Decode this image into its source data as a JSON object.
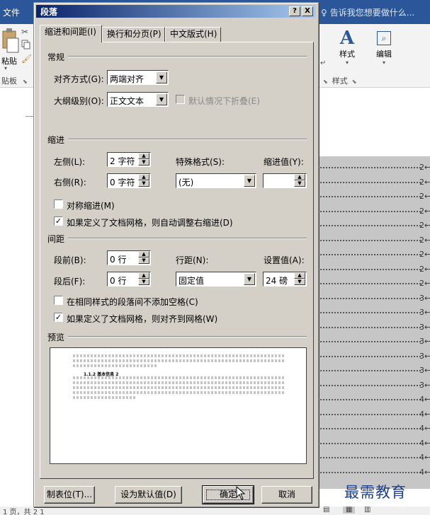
{
  "word": {
    "file_tab": "文件",
    "tell_me": "告诉我您想要做什么...",
    "paste_label": "粘贴",
    "clipboard_group": "贴板",
    "styles_label": "样式",
    "edit_label": "编辑",
    "styles_group": "样式",
    "line_marks": [
      "2←",
      "2←",
      "2←",
      "2←",
      "2←",
      "2←",
      "2←",
      "2←",
      "2←",
      "3←",
      "3←",
      "3←",
      "3←",
      "3←",
      "3←",
      "3←",
      "4←",
      "4←",
      "4←",
      "4←",
      "4←",
      "4←"
    ],
    "status_left": "1 页，共 2 1",
    "watermark": "最需教育"
  },
  "dialog": {
    "title": "段落",
    "help_btn": "?",
    "close_btn": "X",
    "tabs": [
      {
        "label": "缩进和间距(I)"
      },
      {
        "label": "换行和分页(P)"
      },
      {
        "label": "中文版式(H)"
      }
    ],
    "general": {
      "section": "常规",
      "alignment_label": "对齐方式(G):",
      "alignment_value": "两端对齐",
      "outline_label": "大纲级别(O):",
      "outline_value": "正文文本",
      "collapse_label": "默认情况下折叠(E)"
    },
    "indent": {
      "section": "缩进",
      "left_label": "左侧(L):",
      "left_value": "2 字符",
      "right_label": "右侧(R):",
      "right_value": "0 字符",
      "special_label": "特殊格式(S):",
      "special_value": "(无)",
      "by_label": "缩进值(Y):",
      "by_value": "",
      "mirror_label": "对称缩进(M)",
      "auto_adjust_label": "如果定义了文档网格，则自动调整右缩进(D)"
    },
    "spacing": {
      "section": "间距",
      "before_label": "段前(B):",
      "before_value": "0 行",
      "after_label": "段后(F):",
      "after_value": "0 行",
      "line_label": "行距(N):",
      "line_value": "固定值",
      "at_label": "设置值(A):",
      "at_value": "24 磅",
      "no_space_label": "在相同样式的段落间不添加空格(C)",
      "snap_grid_label": "如果定义了文档网格，则对齐到网格(W)"
    },
    "preview": {
      "section": "预览",
      "sample_heading": "1.1.2 基本信息 2"
    },
    "buttons": {
      "tabs": "制表位(T)...",
      "set_default": "设为默认值(D)",
      "ok": "确定",
      "cancel": "取消"
    }
  }
}
